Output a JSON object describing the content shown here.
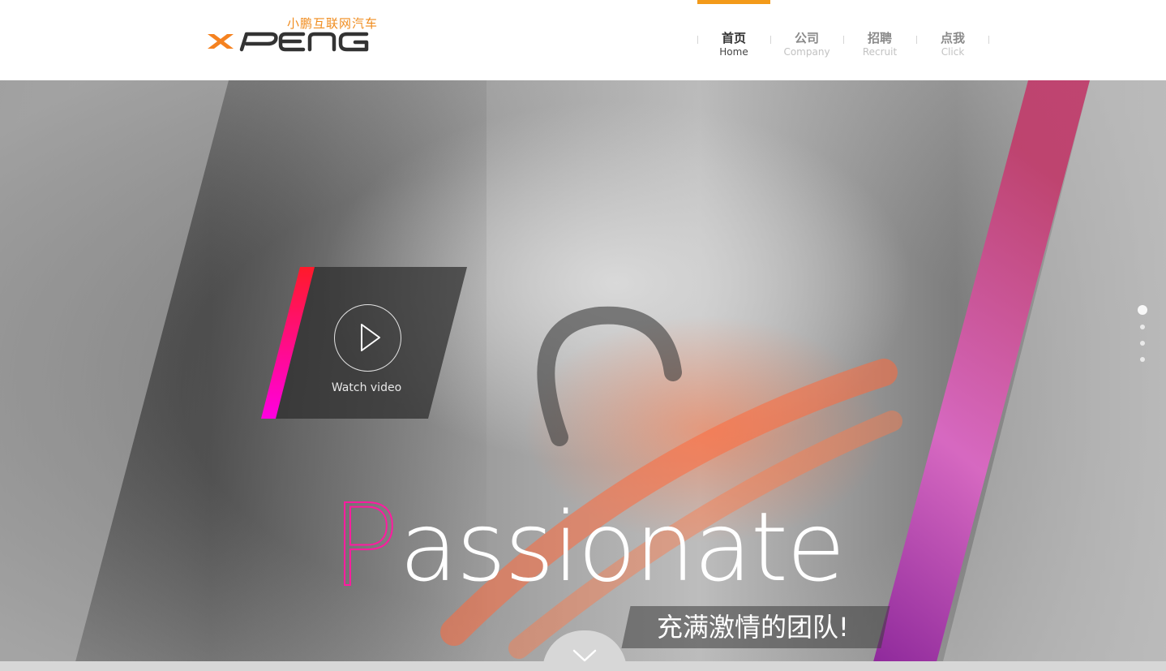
{
  "logo": {
    "cn_text": "小鹏互联网汽车",
    "en_text": "XPENG"
  },
  "nav": [
    {
      "cn": "首页",
      "en": "Home",
      "active": true
    },
    {
      "cn": "公司",
      "en": "Company",
      "active": false
    },
    {
      "cn": "招聘",
      "en": "Recruit",
      "active": false
    },
    {
      "cn": "点我",
      "en": "Click",
      "active": false
    }
  ],
  "hero": {
    "video_label": "Watch video",
    "headline_first": "P",
    "headline_rest": "assionate",
    "subtitle": "充满激情的团队!"
  },
  "pager": {
    "count": 4,
    "active_index": 0
  },
  "colors": {
    "accent_orange": "#f39a1a",
    "brand_orange": "#f08c1e",
    "magenta": "#ff1aa0",
    "purple": "#c030c0"
  },
  "icons": [
    "play-icon",
    "chevron-down-icon"
  ]
}
